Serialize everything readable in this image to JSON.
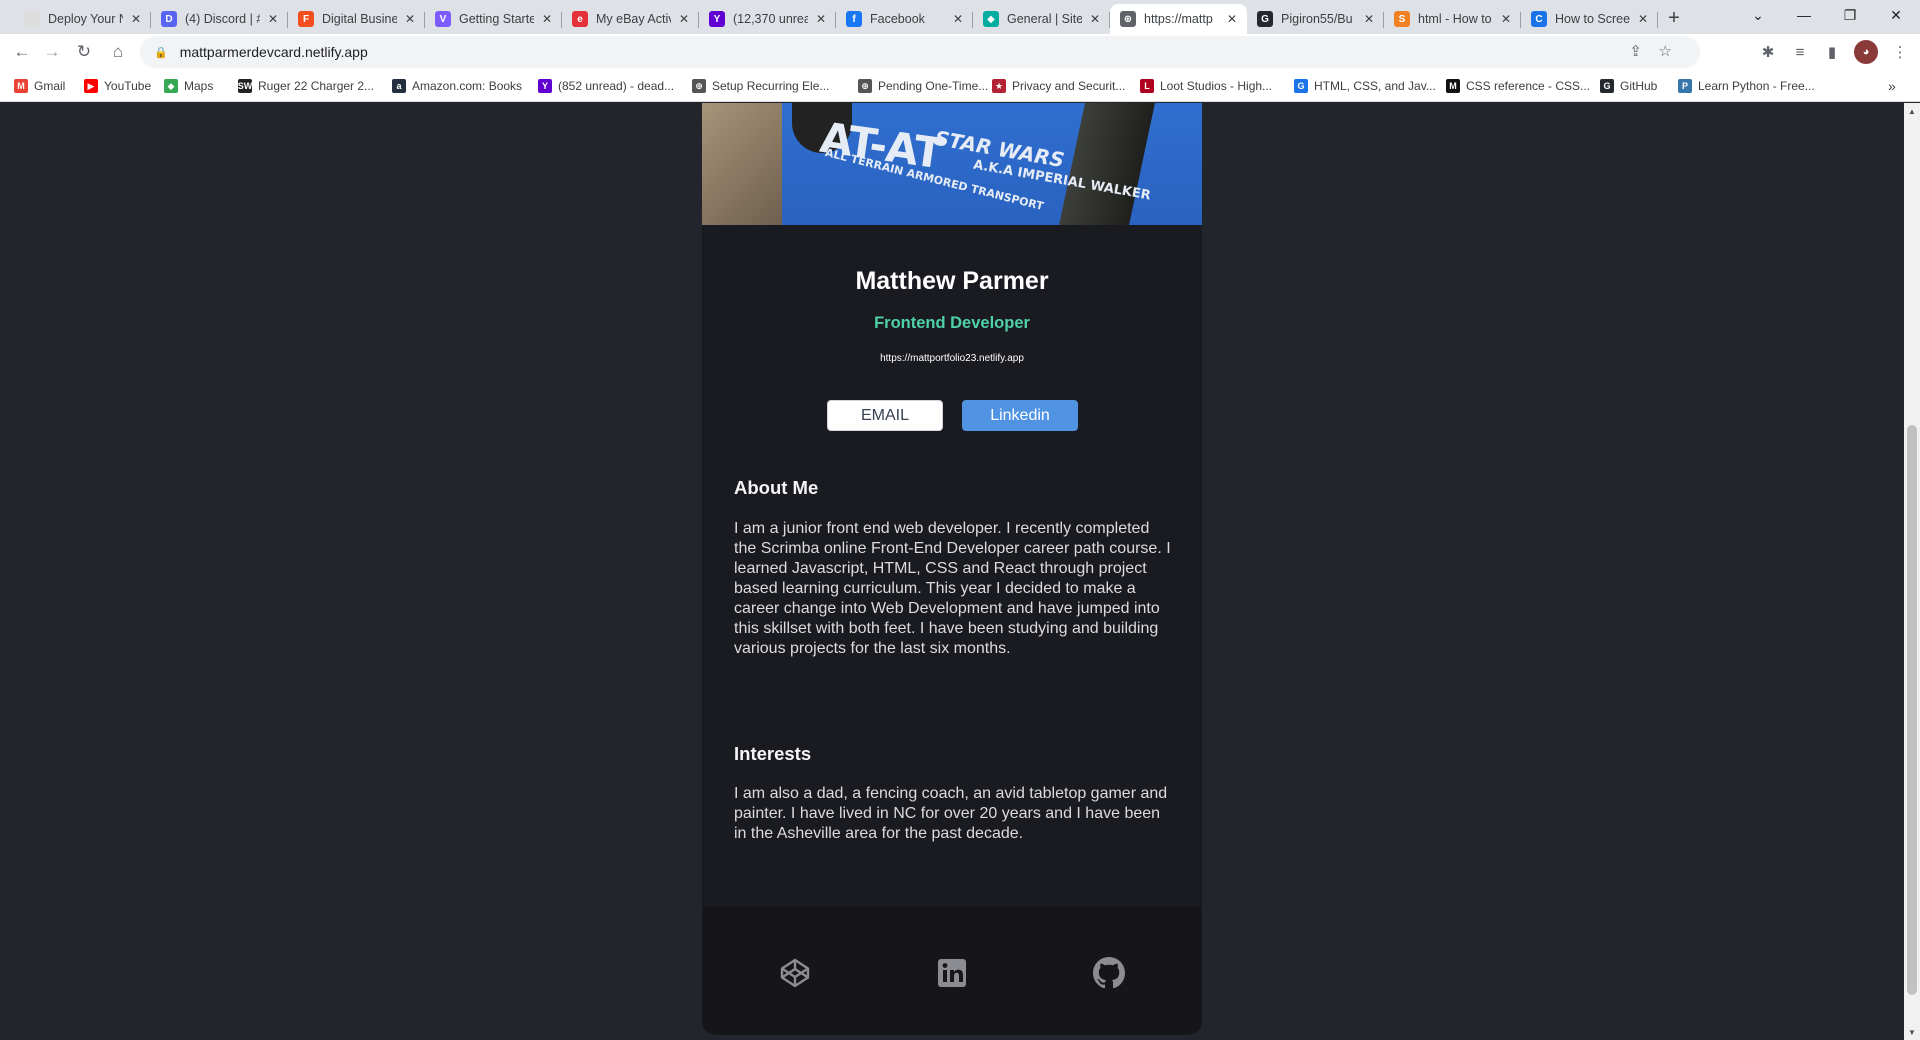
{
  "tabs": [
    {
      "title": "Deploy Your N",
      "active": false,
      "fav_color": "#dddddd",
      "fav_text": ""
    },
    {
      "title": "(4) Discord | #",
      "active": false,
      "fav_color": "#5865f2",
      "fav_text": "D"
    },
    {
      "title": "Digital Busine",
      "active": false,
      "fav_color": "#f24e1e",
      "fav_text": "F"
    },
    {
      "title": "Getting Starte",
      "active": false,
      "fav_color": "#7c5cff",
      "fav_text": "V"
    },
    {
      "title": "My eBay Activ",
      "active": false,
      "fav_color": "#e53238",
      "fav_text": "e"
    },
    {
      "title": "(12,370 unrea",
      "active": false,
      "fav_color": "#6001d2",
      "fav_text": "Y"
    },
    {
      "title": "Facebook",
      "active": false,
      "fav_color": "#1877f2",
      "fav_text": "f"
    },
    {
      "title": "General | Site",
      "active": false,
      "fav_color": "#00ad9f",
      "fav_text": "◆"
    },
    {
      "title": "https://mattp",
      "active": true,
      "fav_color": "#5f6368",
      "fav_text": "⊕"
    },
    {
      "title": "Pigiron55/Bu",
      "active": false,
      "fav_color": "#24292f",
      "fav_text": "G"
    },
    {
      "title": "html - How to",
      "active": false,
      "fav_color": "#f48024",
      "fav_text": "S"
    },
    {
      "title": "How to Scree",
      "active": false,
      "fav_color": "#1a73e8",
      "fav_text": "C"
    }
  ],
  "browser": {
    "url": "mattparmerdevcard.netlify.app"
  },
  "bookmarks": [
    {
      "label": "Gmail",
      "color": "#ea4335",
      "glyph": "M"
    },
    {
      "label": "YouTube",
      "color": "#ff0000",
      "glyph": "▶"
    },
    {
      "label": "Maps",
      "color": "#34a853",
      "glyph": "◆"
    },
    {
      "label": "Ruger 22 Charger 2...",
      "color": "#222222",
      "glyph": "SW"
    },
    {
      "label": "Amazon.com: Books",
      "color": "#232f3e",
      "glyph": "a"
    },
    {
      "label": "(852 unread) - dead...",
      "color": "#6001d2",
      "glyph": "Y"
    },
    {
      "label": "Setup Recurring Ele...",
      "color": "#555555",
      "glyph": "⊕"
    },
    {
      "label": "Pending One-Time...",
      "color": "#555555",
      "glyph": "⊕"
    },
    {
      "label": "Privacy and Securit...",
      "color": "#b22234",
      "glyph": "★"
    },
    {
      "label": "Loot Studios - High...",
      "color": "#b00020",
      "glyph": "L"
    },
    {
      "label": "HTML, CSS, and Jav...",
      "color": "#1a73e8",
      "glyph": "G"
    },
    {
      "label": "CSS reference - CSS...",
      "color": "#111111",
      "glyph": "M"
    },
    {
      "label": "GitHub",
      "color": "#24292f",
      "glyph": "G"
    },
    {
      "label": "Learn Python - Free...",
      "color": "#3776ab",
      "glyph": "P"
    }
  ],
  "card": {
    "name": "Matthew Parmer",
    "role": "Frontend Developer",
    "website": "https://mattportfolio23.netlify.app",
    "email_button": "EMAIL",
    "linkedin_button": "Linkedin",
    "about_heading": "About Me",
    "about_text": "I am a junior front end web developer. I recently completed the Scrimba online Front-End Developer career path course. I learned Javascript, HTML, CSS and React through project based learning curriculum. This year I decided to make a career change into Web Development and have jumped into this skillset with both feet. I have been studying and building various projects for the last six months.",
    "interests_heading": "Interests",
    "interests_text": "I am also a dad, a fencing coach, an avid tabletop gamer and painter. I have lived in NC for over 20 years and I have been in the Asheville area for the past decade.",
    "photo_print": {
      "big": "AT-AT",
      "brand": "STAR WARS",
      "sub1": "ALL TERRAIN ARMORED TRANSPORT",
      "sub2": "A.K.A IMPERIAL WALKER"
    }
  },
  "footer_icons": [
    "codepen-icon",
    "linkedin-icon",
    "github-icon"
  ],
  "colors": {
    "page_bg": "#23252c",
    "card_bg": "#1a1b21",
    "footer_bg": "#161619",
    "accent_green": "#4fd1a5",
    "linkedin_blue": "#5093e2"
  }
}
